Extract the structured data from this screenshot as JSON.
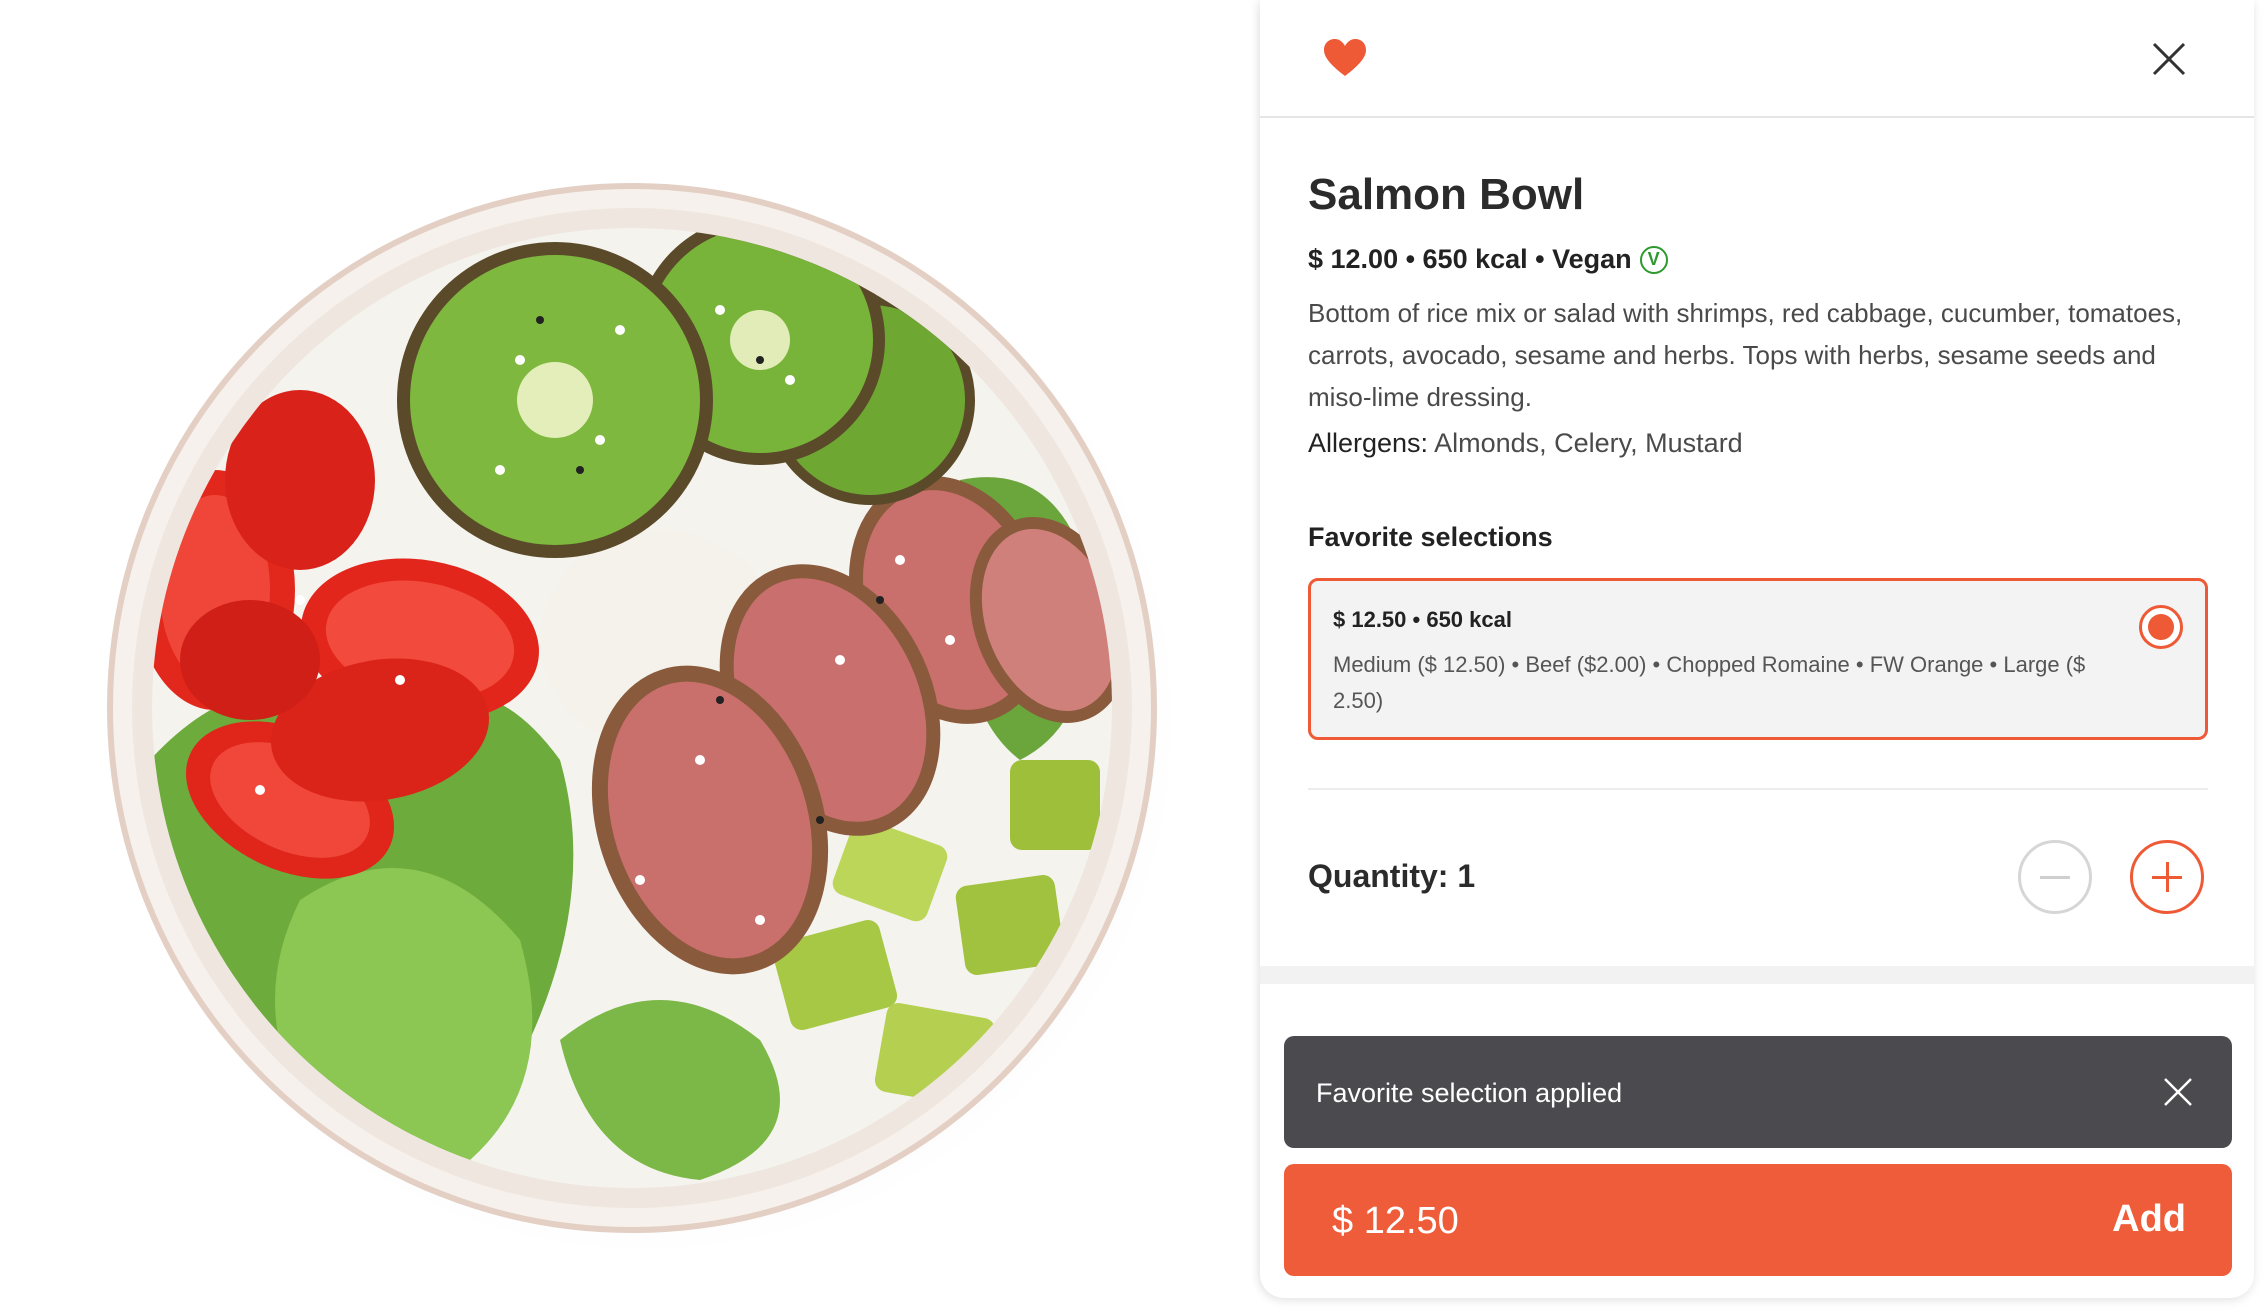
{
  "product": {
    "image_alt": "Salmon bowl with kiwi, tomatoes, seared fish, lettuce and avocado",
    "title": "Salmon Bowl",
    "meta": "$ 12.00 • 650 kcal • Vegan",
    "vegan_badge": "V",
    "description": "Bottom of rice mix or salad with shrimps, red cabbage, cucumber, tomatoes, carrots, avocado, sesame and herbs. Tops with herbs, sesame seeds and miso-lime dressing.",
    "allergens_label": "Allergens:",
    "allergens": "Almonds, Celery, Mustard"
  },
  "header": {
    "favorite_icon": "heart-icon",
    "close_icon": "close-icon"
  },
  "favorites": {
    "heading": "Favorite selections",
    "items": [
      {
        "price": "$ 12.50 • 650 kcal",
        "options": "Medium ($ 12.50) • Beef ($2.00) • Chopped Romaine • FW Orange • Large ($ 2.50)",
        "selected": true
      }
    ]
  },
  "quantity": {
    "label": "Quantity: 1",
    "value": 1
  },
  "toast": {
    "message": "Favorite selection applied"
  },
  "add_bar": {
    "price": "$ 12.50",
    "label": "Add"
  },
  "colors": {
    "accent": "#ee5a36",
    "toast_bg": "#4b4b4f",
    "vegan": "#2e9a2e"
  }
}
